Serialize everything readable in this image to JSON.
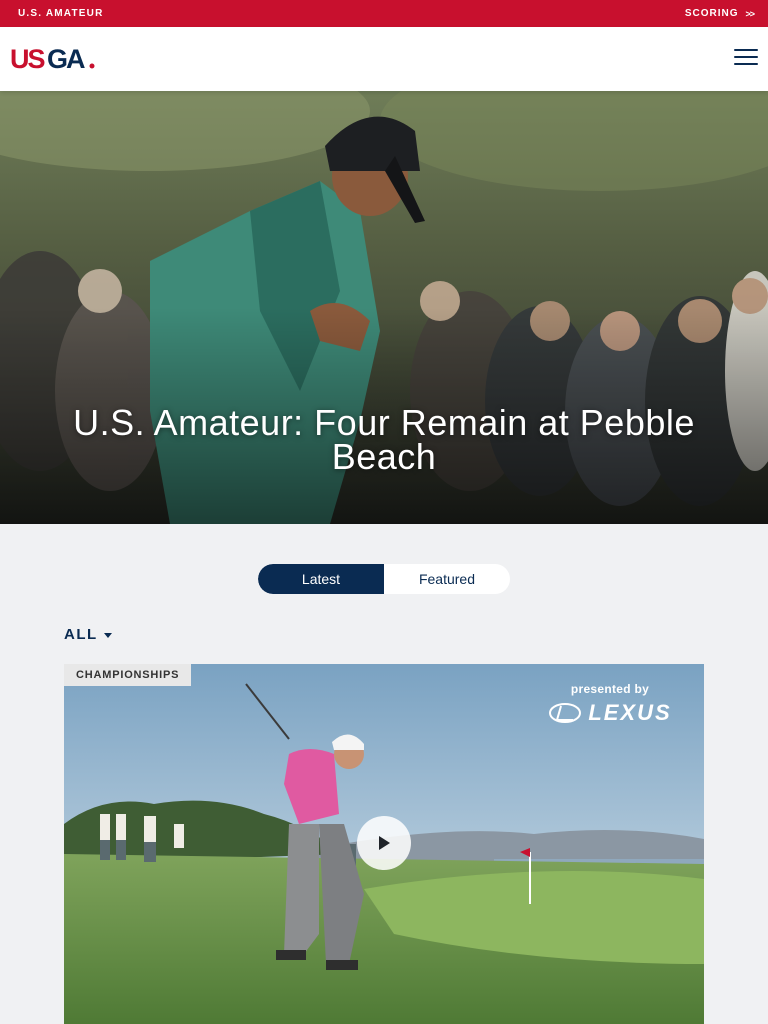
{
  "topbar": {
    "left_label": "U.S. AMATEUR",
    "right_label": "SCORING",
    "right_chevrons": ">>"
  },
  "header": {
    "logo_alt": "USGA",
    "menu_icon": "hamburger-menu-icon"
  },
  "hero": {
    "title": "U.S. Amateur: Four Remain at Pebble Beach"
  },
  "toggle": {
    "options": [
      "Latest",
      "Featured"
    ],
    "active": "Latest"
  },
  "filter": {
    "label": "ALL",
    "icon": "caret-down-icon"
  },
  "card": {
    "badge": "CHAMPIONSHIPS",
    "sponsor_presented": "presented by",
    "sponsor_brand": "LEXUS",
    "play_icon": "play-icon"
  },
  "colors": {
    "brand_red": "#c8102e",
    "navy": "#0a2b52",
    "page_bg": "#f0f1f3"
  }
}
